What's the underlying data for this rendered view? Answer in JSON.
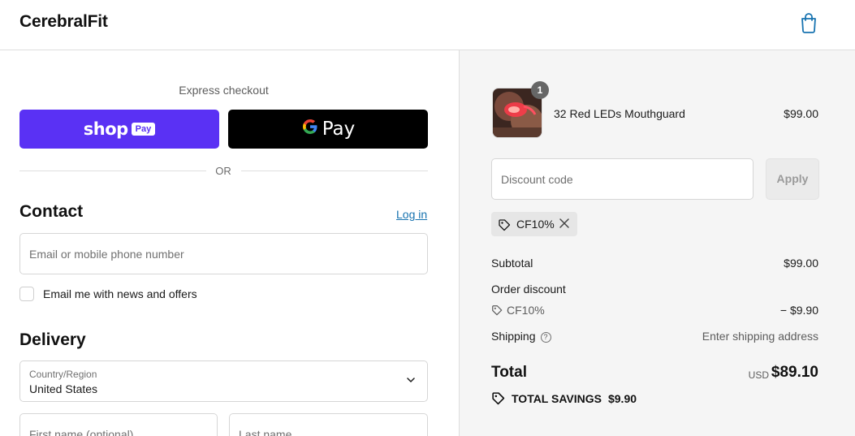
{
  "header": {
    "brand": "CerebralFit",
    "cart_icon": "shopping-bag-icon"
  },
  "express": {
    "label": "Express checkout",
    "shop_pay": {
      "word": "shop",
      "badge": "Pay"
    },
    "google_pay": {
      "g": "G",
      "word": "Pay"
    },
    "or": "OR"
  },
  "contact": {
    "title": "Contact",
    "login": "Log in",
    "email_placeholder": "Email or mobile phone number",
    "newsletter_label": "Email me with news and offers"
  },
  "delivery": {
    "title": "Delivery",
    "country_label": "Country/Region",
    "country_value": "United States",
    "first_name_placeholder": "First name (optional)",
    "last_name_placeholder": "Last name"
  },
  "summary": {
    "item": {
      "quantity": "1",
      "name": "32 Red LEDs Mouthguard",
      "price": "$99.00"
    },
    "discount_placeholder": "Discount code",
    "apply_label": "Apply",
    "applied_code": "CF10%",
    "subtotal_label": "Subtotal",
    "subtotal_value": "$99.00",
    "order_discount_label": "Order discount",
    "order_discount_code": "CF10%",
    "order_discount_value": "− $9.90",
    "shipping_label": "Shipping",
    "shipping_value": "Enter shipping address",
    "total_label": "Total",
    "total_currency": "USD",
    "total_value": "$89.10",
    "savings_label": "TOTAL SAVINGS",
    "savings_value": "$9.90"
  },
  "colors": {
    "shop_pay": "#5a31f4",
    "link": "#1773b0",
    "summary_bg": "#f5f5f5"
  }
}
